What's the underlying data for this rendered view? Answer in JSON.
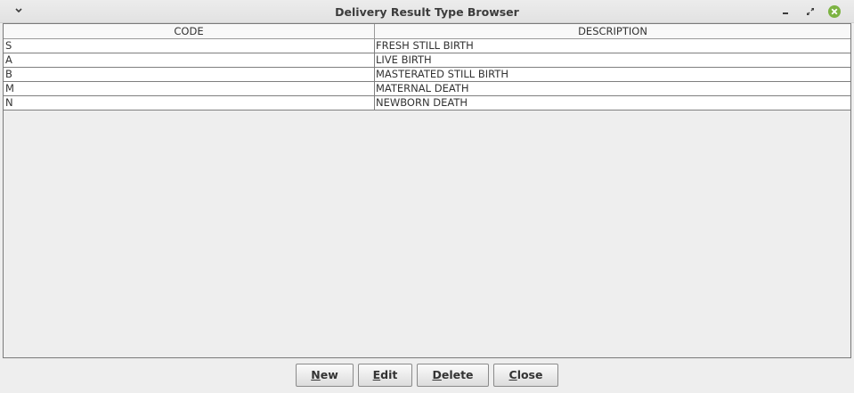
{
  "window": {
    "title": "Delivery Result Type Browser"
  },
  "table": {
    "columns": [
      "CODE",
      "DESCRIPTION"
    ],
    "rows": [
      {
        "code": "S",
        "description": "FRESH STILL BIRTH"
      },
      {
        "code": "A",
        "description": "LIVE BIRTH"
      },
      {
        "code": "B",
        "description": "MASTERATED STILL BIRTH"
      },
      {
        "code": "M",
        "description": "MATERNAL DEATH"
      },
      {
        "code": "N",
        "description": "NEWBORN DEATH"
      }
    ]
  },
  "buttons": {
    "new": {
      "mnemonic": "N",
      "rest": "ew"
    },
    "edit": {
      "mnemonic": "E",
      "rest": "dit"
    },
    "delete": {
      "mnemonic": "D",
      "rest": "elete"
    },
    "close": {
      "mnemonic": "C",
      "rest": "lose"
    }
  },
  "icons": {
    "menu": "chevron-down-icon",
    "minimize": "minimize-icon",
    "maximize": "maximize-icon",
    "close": "close-icon"
  },
  "colors": {
    "close_button": "#7cb342",
    "window_bg": "#eeeeee",
    "row_bg": "#ffffff"
  }
}
